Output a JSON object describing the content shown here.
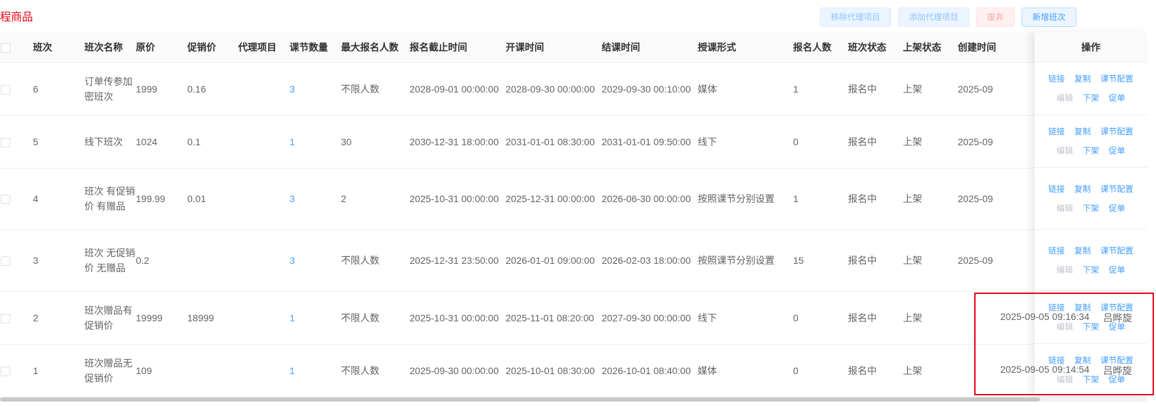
{
  "page": {
    "title": "程商品"
  },
  "toolbar": {
    "remove_proxy": "移除代理项目",
    "add_proxy": "添加代理项目",
    "discard": "废弃",
    "add_class": "新增班次"
  },
  "table": {
    "headers": {
      "id": "班次",
      "name": "班次名称",
      "price": "原价",
      "promo": "促销价",
      "proxy": "代理项目",
      "lessons": "课节数量",
      "max": "最大报名人数",
      "deadline": "报名截止时间",
      "start": "开课时间",
      "end": "结课时间",
      "mode": "授课形式",
      "enrolled": "报名人数",
      "status": "班次状态",
      "shelf": "上架状态",
      "created": "创建时间",
      "ops": "操作"
    },
    "rows": [
      {
        "id": "6",
        "name": "订单传参加密班次",
        "price": "1999",
        "promo": "0.16",
        "proxy": "",
        "lessons": "3",
        "max": "不限人数",
        "deadline": "2028-09-01 00:00:00",
        "start": "2028-09-30 00:00:00",
        "end": "2029-09-30 00:10:00",
        "mode": "媒体",
        "enrolled": "1",
        "status": "报名中",
        "shelf": "上架",
        "created": "2025-09"
      },
      {
        "id": "5",
        "name": "线下班次",
        "price": "1024",
        "promo": "0.1",
        "proxy": "",
        "lessons": "1",
        "max": "30",
        "deadline": "2030-12-31 18:00:00",
        "start": "2031-01-01 08:30:00",
        "end": "2031-01-01 09:50:00",
        "mode": "线下",
        "enrolled": "0",
        "status": "报名中",
        "shelf": "上架",
        "created": "2025-09"
      },
      {
        "id": "4",
        "name": "班次 有促销价 有赠品",
        "price": "199.99",
        "promo": "0.01",
        "proxy": "",
        "lessons": "3",
        "max": "2",
        "deadline": "2025-10-31 00:00:00",
        "start": "2025-12-31 00:00:00",
        "end": "2026-06-30 00:00:00",
        "mode": "按照课节分别设置",
        "enrolled": "1",
        "status": "报名中",
        "shelf": "上架",
        "created": "2025-09"
      },
      {
        "id": "3",
        "name": "班次 无促销价 无赠品",
        "price": "0.2",
        "promo": "",
        "proxy": "",
        "lessons": "3",
        "max": "不限人数",
        "deadline": "2025-12-31 23:50:00",
        "start": "2026-01-01 09:00:00",
        "end": "2026-02-03 18:00:00",
        "mode": "按照课节分别设置",
        "enrolled": "15",
        "status": "报名中",
        "shelf": "上架",
        "created": "2025-09"
      },
      {
        "id": "2",
        "name": "班次赠品有促销价",
        "price": "19999",
        "promo": "18999",
        "proxy": "",
        "lessons": "1",
        "max": "不限人数",
        "deadline": "2025-10-31 00:00:00",
        "start": "2025-11-01 08:20:00",
        "end": "2027-09-30 00:00:00",
        "mode": "线下",
        "enrolled": "0",
        "status": "报名中",
        "shelf": "上架",
        "created": "2025-09-05 09:16:34",
        "creator": "吕晔旋"
      },
      {
        "id": "1",
        "name": "班次赠品无促销价",
        "price": "109",
        "promo": "",
        "proxy": "",
        "lessons": "1",
        "max": "不限人数",
        "deadline": "2025-09-30 00:00:00",
        "start": "2025-10-01 08:30:00",
        "end": "2026-10-01 08:40:00",
        "mode": "媒体",
        "enrolled": "0",
        "status": "报名中",
        "shelf": "上架",
        "created": "2025-09-05 09:14:54",
        "creator": "吕晔旋"
      }
    ]
  },
  "ops": {
    "link": "链接",
    "copy": "复制",
    "lesson_config": "课节配置",
    "edit": "编辑",
    "unshelve": "下架",
    "promote": "促单"
  }
}
